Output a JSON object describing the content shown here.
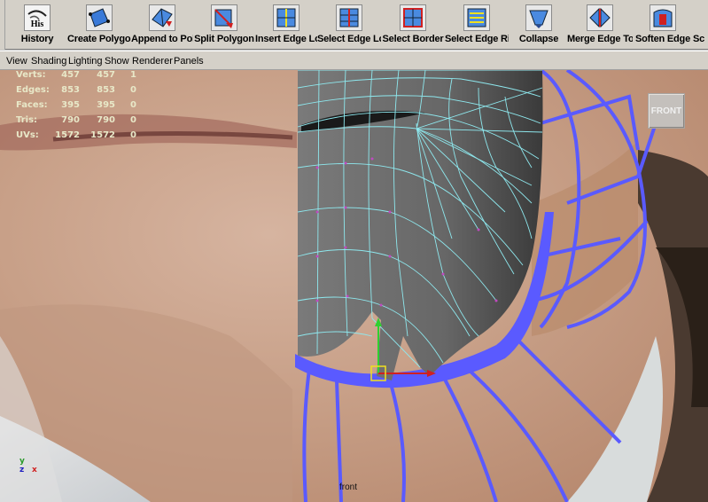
{
  "shelf": {
    "tools": [
      {
        "id": "history",
        "label": "History",
        "icon": "history-icon",
        "icon_text": "His"
      },
      {
        "id": "create-polygon",
        "label": "Create Polygon",
        "icon": "create-polygon-icon"
      },
      {
        "id": "append-to-polygon",
        "label": "Append to Polygon",
        "icon": "append-polygon-icon"
      },
      {
        "id": "split-polygon",
        "label": "Split Polygon",
        "icon": "split-polygon-icon"
      },
      {
        "id": "insert-edge-loop",
        "label": "Insert Edge Loop",
        "icon": "insert-edge-loop-icon"
      },
      {
        "id": "select-edge-loop",
        "label": "Select Edge Loop",
        "icon": "select-edge-loop-icon"
      },
      {
        "id": "select-border",
        "label": "Select Border",
        "icon": "select-border-icon"
      },
      {
        "id": "select-edge-ring",
        "label": "Select Edge Ring",
        "icon": "select-edge-ring-icon"
      },
      {
        "id": "collapse",
        "label": "Collapse",
        "icon": "collapse-icon"
      },
      {
        "id": "merge-edge-tool",
        "label": "Merge Edge Tool",
        "icon": "merge-edge-icon"
      },
      {
        "id": "soften-edge",
        "label": "Soften Edge",
        "icon": "soften-edge-icon"
      },
      {
        "id": "sc",
        "label": "Sc",
        "icon": "scale-icon"
      }
    ]
  },
  "menubar": {
    "items": [
      "View",
      "Shading",
      "Lighting",
      "Show",
      "Renderer",
      "Panels"
    ]
  },
  "viewport": {
    "hud": [
      {
        "label": "Verts:",
        "v1": "457",
        "v2": "457",
        "v3": "1"
      },
      {
        "label": "Edges:",
        "v1": "853",
        "v2": "853",
        "v3": "0"
      },
      {
        "label": "Faces:",
        "v1": "395",
        "v2": "395",
        "v3": "0"
      },
      {
        "label": "Tris:",
        "v1": "790",
        "v2": "790",
        "v3": "0"
      },
      {
        "label": "UVs:",
        "v1": "1572",
        "v2": "1572",
        "v3": "0"
      }
    ],
    "view_cube_label": "FRONT",
    "camera_name": "front",
    "axis": {
      "y": "y",
      "z": "z",
      "x": "x"
    },
    "colors": {
      "wireframe": "#8ee8ee",
      "blue_mesh": "#5a5aff",
      "mesh_fill": "#6e6e6e",
      "hud_text": "#e8e8c8"
    }
  }
}
